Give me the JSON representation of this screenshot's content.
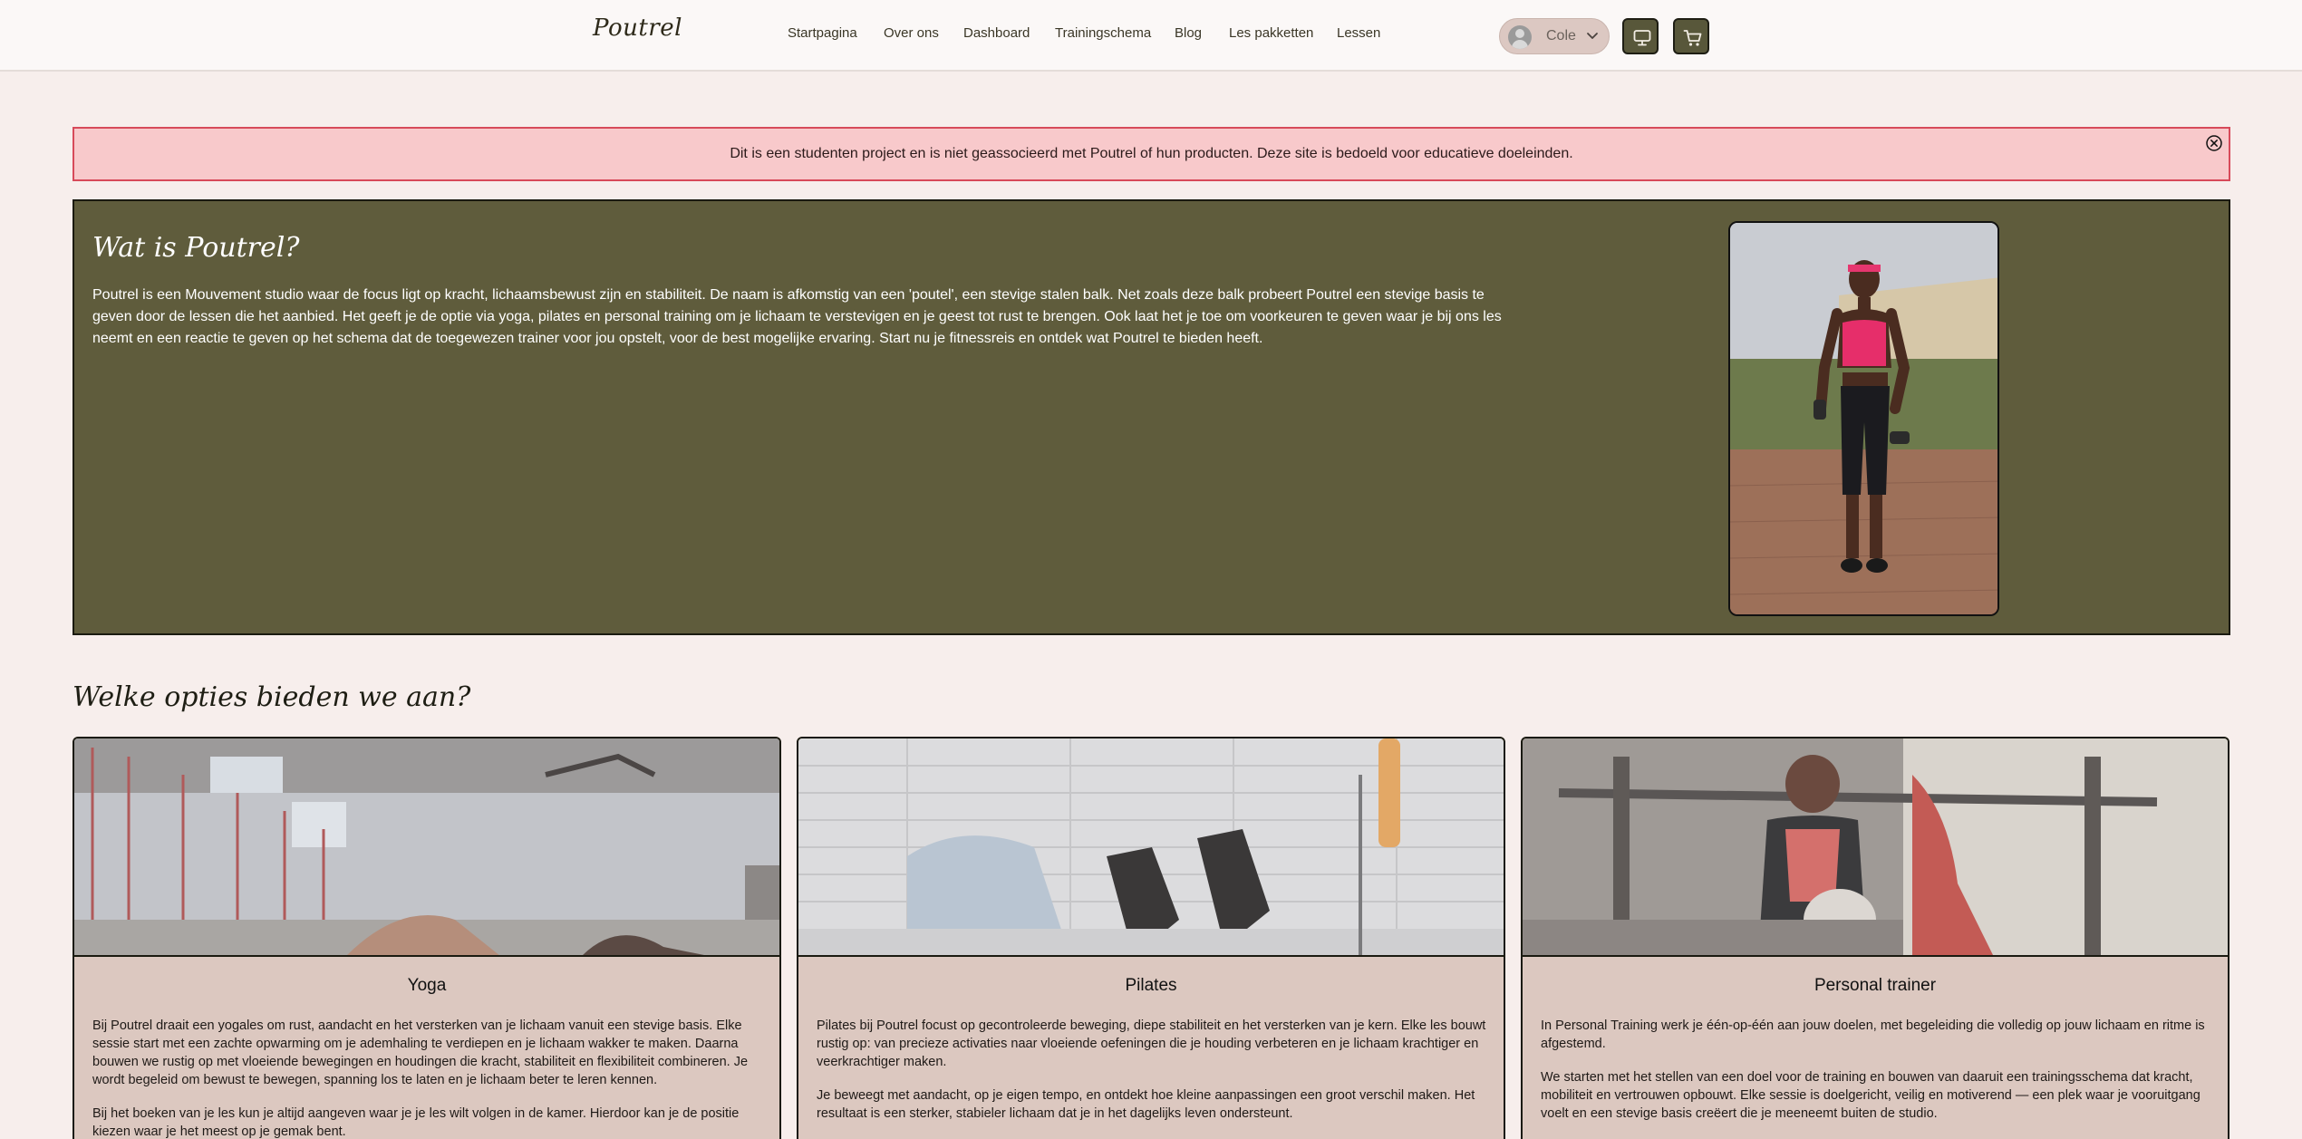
{
  "header": {
    "logo": "Poutrel",
    "nav": [
      {
        "label": "Startpagina",
        "name": "nav-startpagina"
      },
      {
        "label": "Over ons",
        "name": "nav-over-ons"
      },
      {
        "label": "Dashboard",
        "name": "nav-dashboard"
      },
      {
        "label": "Trainingschema",
        "name": "nav-trainingschema"
      },
      {
        "label": "Blog",
        "name": "nav-blog"
      },
      {
        "label": "Les pakketten",
        "name": "nav-les-pakketten"
      },
      {
        "label": "Lessen",
        "name": "nav-lessen"
      }
    ],
    "user": {
      "name": "Cole"
    },
    "icons": {
      "screen": "monitor-icon",
      "cart": "cart-icon"
    }
  },
  "notice": {
    "text": "Dit is een studenten project en is niet geassocieerd met Poutrel of hun producten. Deze site is bedoeld voor educatieve doeleinden."
  },
  "hero": {
    "title": "Wat is Poutrel?",
    "text": "Poutrel is een Mouvement studio waar de focus ligt op kracht, lichaamsbewust zijn en stabiliteit. De naam is afkomstig van een 'poutel', een stevige stalen balk. Net zoals deze balk probeert Poutrel een stevige basis te geven door de lessen die het aanbied. Het geeft je de optie via yoga, pilates en personal training om je lichaam te verstevigen en je geest tot rust te brengen. Ook laat het je toe om voorkeuren te geven waar je bij ons les neemt en een reactie te geven op het schema dat de toegewezen trainer voor jou opstelt, voor de best mogelijke ervaring. Start nu je fitnessreis en ontdek wat Poutrel te bieden heeft."
  },
  "options": {
    "title": "Welke opties bieden we aan?",
    "cards": [
      {
        "title": "Yoga",
        "paragraphs": [
          "Bij Poutrel draait een yogales om rust, aandacht en het versterken van je lichaam vanuit een stevige basis. Elke sessie start met een zachte opwarming om je ademhaling te verdiepen en je lichaam wakker te maken. Daarna bouwen we rustig op met vloeiende bewegingen en houdingen die kracht, stabiliteit en flexibiliteit combineren. Je wordt begeleid om bewust te bewegen, spanning los te laten en je lichaam beter te leren kennen.",
          "Bij het boeken van je les kun je altijd aangeven waar je je les wilt volgen in de kamer. Hierdoor kan je de positie kiezen waar je het meest op je gemak bent."
        ]
      },
      {
        "title": "Pilates",
        "paragraphs": [
          "Pilates bij Poutrel focust op gecontroleerde beweging, diepe stabiliteit en het versterken van je kern. Elke les bouwt rustig op: van precieze activaties naar vloeiende oefeningen die je houding verbeteren en je lichaam krachtiger en veerkrachtiger maken.",
          "Je beweegt met aandacht, op je eigen tempo, en ontdekt hoe kleine aanpassingen een groot verschil maken. Het resultaat is een sterker, stabieler lichaam dat je in het dagelijks leven ondersteunt."
        ]
      },
      {
        "title": "Personal trainer",
        "paragraphs": [
          "In Personal Training werk je één-op-één aan jouw doelen, met begeleiding die volledig op jouw lichaam en ritme is afgestemd.",
          "We starten met het stellen van een doel voor de training en bouwen van daaruit een trainingsschema dat kracht, mobiliteit en vertrouwen opbouwt. Elke sessie is doelgericht, veilig en motiverend — een plek waar je vooruitgang voelt en een stevige basis creëert die je meeneemt buiten de studio."
        ]
      }
    ]
  }
}
